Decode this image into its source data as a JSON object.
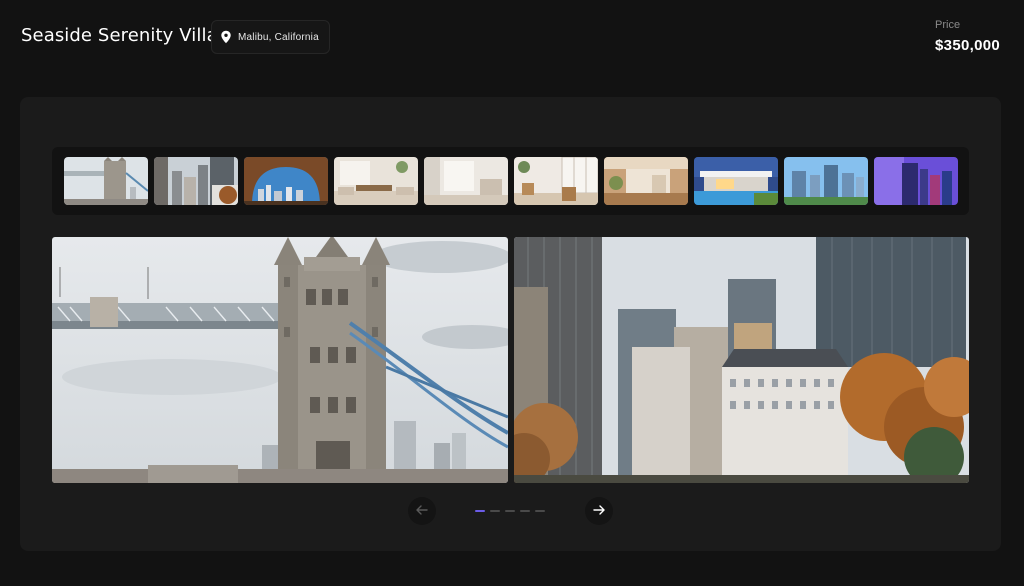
{
  "listing": {
    "title": "Seaside Serenity Villa",
    "location": "Malibu, California",
    "price_label": "Price",
    "price_value": "$350,000"
  },
  "icons": {
    "location": "map-pin-icon",
    "prev": "arrow-left-icon",
    "next": "arrow-right-icon"
  },
  "colors": {
    "page_bg": "#121212",
    "card_bg": "#1b1b1b",
    "accent": "#6b5ce7"
  },
  "gallery": {
    "thumbnails": [
      "tower-bridge",
      "city-skyline",
      "rock-arch-skyline",
      "interior-living-room",
      "interior-bright-room",
      "interior-dining",
      "interior-wooden-hall",
      "modern-villa-pool",
      "glass-towers",
      "purple-towers"
    ],
    "main_photos": [
      "tower-bridge",
      "city-skyline"
    ],
    "page_count": 5,
    "active_page": 1
  }
}
